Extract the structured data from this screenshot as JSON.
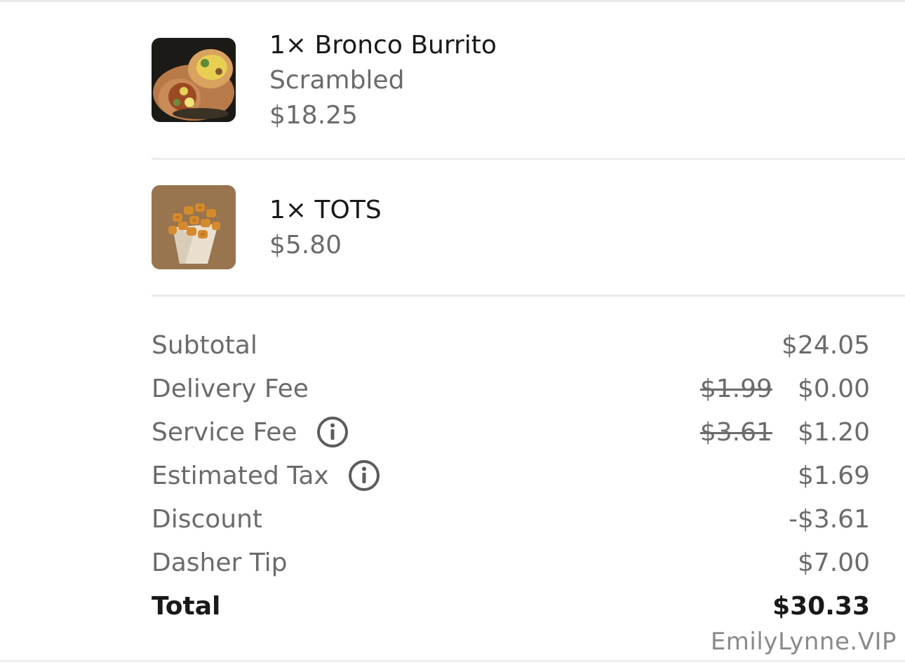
{
  "items": [
    {
      "name": "1× Bronco Burrito",
      "option": "Scrambled",
      "price": "$18.25",
      "image_icon": "burrito-photo"
    },
    {
      "name": "1× TOTS",
      "price": "$5.80",
      "image_icon": "tots-photo"
    }
  ],
  "summary": {
    "subtotal": {
      "label": "Subtotal",
      "value": "$24.05"
    },
    "delivery_fee": {
      "label": "Delivery Fee",
      "original": "$1.99",
      "value": "$0.00"
    },
    "service_fee": {
      "label": "Service Fee",
      "original": "$3.61",
      "value": "$1.20",
      "icon": "info-icon"
    },
    "estimated_tax": {
      "label": "Estimated Tax",
      "value": "$1.69",
      "icon": "info-icon"
    },
    "discount": {
      "label": "Discount",
      "value": "-$3.61"
    },
    "dasher_tip": {
      "label": "Dasher Tip",
      "value": "$7.00"
    },
    "total": {
      "label": "Total",
      "value": "$30.33"
    }
  },
  "watermark": "EmilyLynne.VIP",
  "colors": {
    "primary_text": "#191919",
    "secondary_text": "#6b6b6b",
    "divider": "#ececec"
  }
}
